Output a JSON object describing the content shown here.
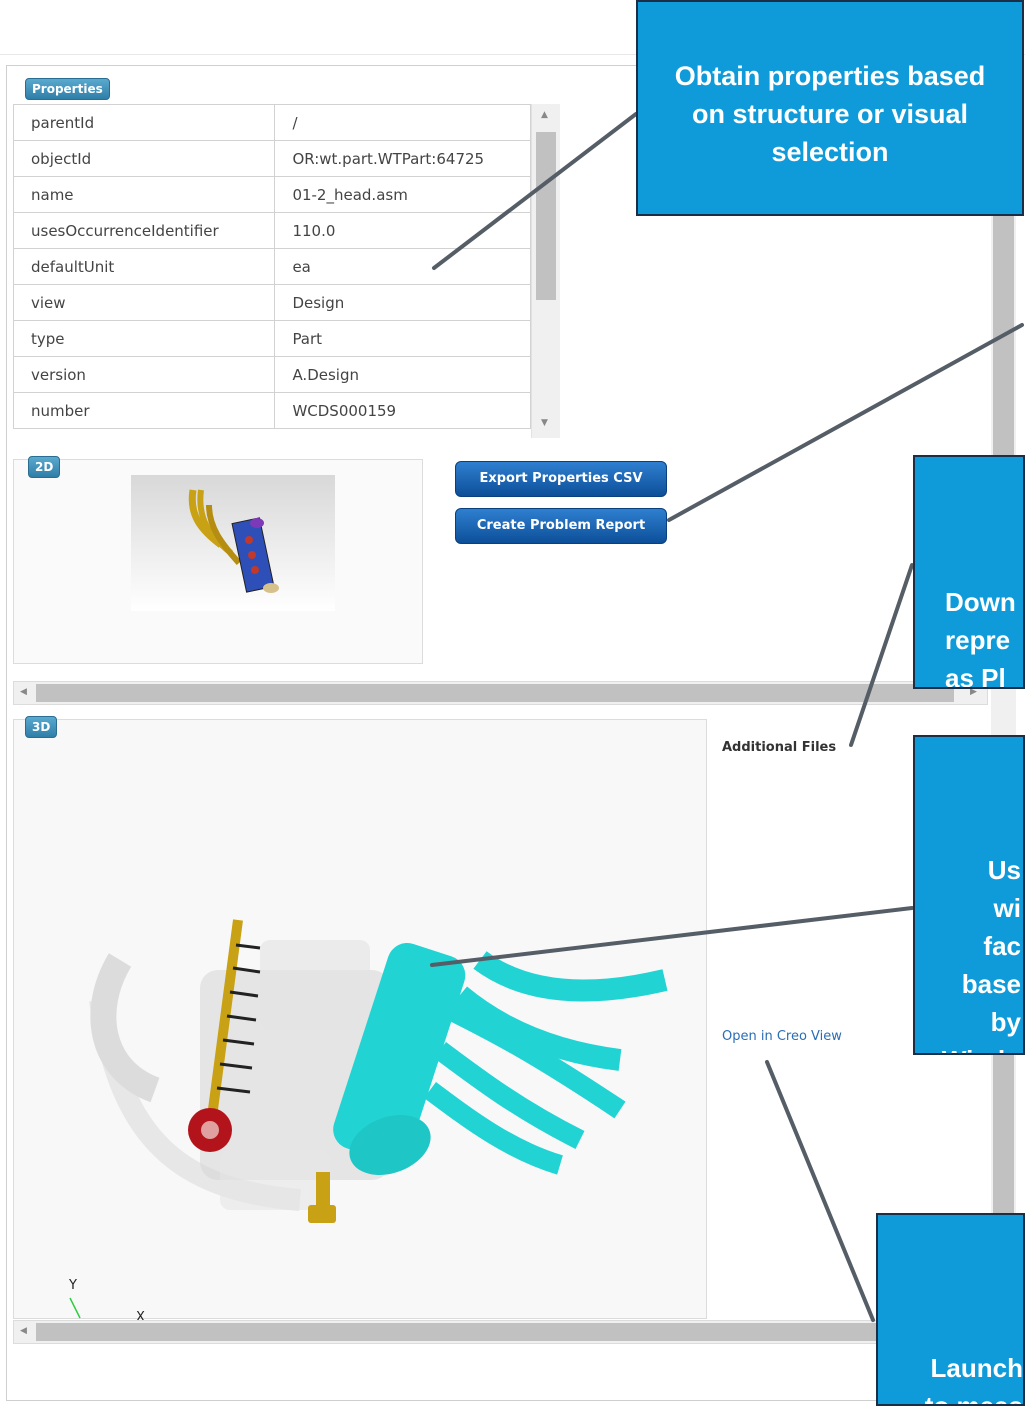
{
  "properties": {
    "tag": "Properties",
    "rows": [
      {
        "key": "parentId",
        "value": "/"
      },
      {
        "key": "objectId",
        "value": "OR:wt.part.WTPart:64725"
      },
      {
        "key": "name",
        "value": "01-2_head.asm"
      },
      {
        "key": "usesOccurrenceIdentifier",
        "value": "110.0"
      },
      {
        "key": "defaultUnit",
        "value": "ea"
      },
      {
        "key": "view",
        "value": "Design"
      },
      {
        "key": "type",
        "value": "Part"
      },
      {
        "key": "version",
        "value": "A.Design"
      },
      {
        "key": "number",
        "value": "WCDS000159"
      }
    ]
  },
  "panel2d": {
    "tag": "2D"
  },
  "buttons": {
    "export": "Export Properties CSV",
    "problem": "Create Problem Report"
  },
  "panel3d": {
    "tag": "3D",
    "axis_y": "Y",
    "axis_x": "X"
  },
  "sidebar": {
    "additional_files": "Additional Files",
    "open_creo": "Open in Creo View"
  },
  "callouts": {
    "c1": "Obtain properties based on structure or visual selection",
    "c2": "Down\nrepre\nas Pl",
    "c3": "Us\nwi\nfac\nbase\nby\nWindo",
    "c4": "Launch\nto meas\nand"
  },
  "colors": {
    "callout": "#0f9bd9",
    "button": "#1a64b8",
    "cyan_part": "#22d3d3"
  }
}
